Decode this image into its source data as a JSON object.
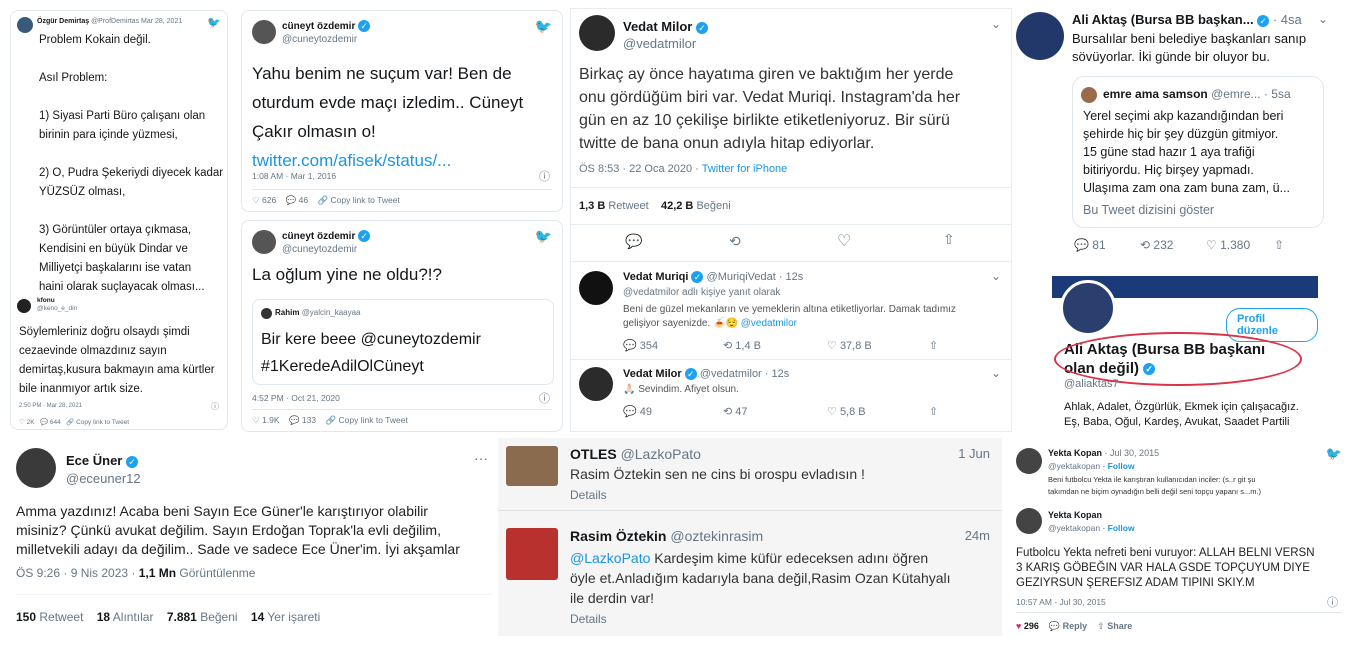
{
  "p1": {
    "user": "Özgür Demirtaş",
    "handle": "@ProfDemirtas",
    "date": "Mar 28, 2021",
    "lines": [
      "Problem Kokain değil.",
      "Asıl Problem:",
      "1) Siyasi Parti Büro çalışanı olan",
      "birinin para içinde yüzmesi,",
      "2) O, Pudra Şekeriydi diyecek kadar",
      "YÜZSÜZ olması,",
      "3) Görüntüler ortaya çıkmasa,",
      "Kendisini en büyük Dindar ve",
      "Milliyetçi başkalarını ise vatan",
      "haini olarak suçlayacak olması..."
    ],
    "reply_user": "kfonu",
    "reply_handle": "@keno_e_din",
    "reply_lines": [
      "Söylemleriniz doğru olsaydı şimdi",
      "cezaevinde olmazdınız sayın",
      "demirtaş,kusura bakmayın ama kürtler",
      "bile inanmıyor artık size."
    ],
    "footer_time": "2:50 PM · Mar 28, 2021",
    "likes": "2K",
    "retweets": "644",
    "copy": "Copy link to Tweet"
  },
  "p2": {
    "user": "cüneyt özdemir",
    "handle": "@cuneytozdemir",
    "lines": [
      "Yahu benim ne suçum var! Ben de",
      "oturdum evde maçı izledim.. Cüneyt",
      "Çakır olmasın o!"
    ],
    "link": "twitter.com/afisek/status/...",
    "time": "1:08 AM · Mar 1, 2016",
    "likes": "626",
    "retweets": "46",
    "copy": "Copy link to Tweet"
  },
  "p3": {
    "user": "cüneyt özdemir",
    "handle": "@cuneytozdemir",
    "text": "La oğlum yine ne oldu?!?",
    "quote_user": "Rahim",
    "quote_handle": "@yalcin_kaayaa",
    "quote_lines": [
      "Bir kere beee @cuneytozdemir",
      "#1KeredeAdilOlCüneyt"
    ],
    "time": "4:52 PM · Oct 21, 2020",
    "likes": "1.9K",
    "retweets": "133",
    "copy": "Copy link to Tweet"
  },
  "p4": {
    "user": "Vedat Milor",
    "handle": "@vedatmilor",
    "lines": [
      "Birkaç ay önce hayatıma giren ve baktığım her yerde",
      "onu gördüğüm biri var. Vedat Muriqi. Instagram'da her",
      "gün en az 10 çekilişe birlikte etiketleniyoruz. Bir sürü",
      "twitte de bana onun adıyla hitap ediyorlar."
    ],
    "time": "ÖS 8:53 · 22 Oca 2020 · ",
    "source": "Twitter for iPhone",
    "retweets_n": "1,3 B",
    "retweets_l": "Retweet",
    "likes_n": "42,2 B",
    "likes_l": "Beğeni",
    "r1_user": "Vedat Muriqi",
    "r1_handle": "@MuriqiVedat · 12s",
    "r1_replying": "@vedatmilor adlı kişiye yanıt olarak",
    "r1_lines": [
      "Beni de güzel mekanların ve yemeklerin altına etiketliyorlar. Damak tadımız",
      "gelişiyor sayenizde."
    ],
    "r1_mention": "@vedatmilor",
    "r1_replies": "354",
    "r1_rts": "1,4 B",
    "r1_likes": "37,8 B",
    "r2_user": "Vedat Milor",
    "r2_handle": "@vedatmilor · 12s",
    "r2_text": "Sevindim. Afiyet olsun.",
    "r2_replies": "49",
    "r2_rts": "47",
    "r2_likes": "5,8 B"
  },
  "p5": {
    "user": "Ali Aktaş (Bursa BB başkan...",
    "time": "4sa",
    "lines": [
      "Bursalılar beni belediye başkanları sanıp",
      "sövüyorlar. İki günde bir oluyor bu."
    ],
    "q_user": "emre ama samson",
    "q_handle": "@emre...",
    "q_time": "5sa",
    "q_lines": [
      "Yerel seçimi akp kazandığından beri",
      "şehirde hiç bir şey düzgün gitmiyor.",
      "15 güne stad hazır 1 aya trafiği",
      "bitiriyordu. Hiç birşey yapmadı.",
      "Ulaşıma zam ona zam buna zam, ü..."
    ],
    "q_thread": "Bu Tweet dizisini göster",
    "replies": "81",
    "rts": "232",
    "likes": "1.380"
  },
  "p6": {
    "edit": "Profil düzenle",
    "name_l1": "Ali Aktaş (Bursa BB başkanı",
    "name_l2": "olan değil)",
    "handle": "@aliaktas7",
    "bio1": "Ahlak, Adalet, Özgürlük, Ekmek için çalışacağız.",
    "bio2": "Eş, Baba, Oğul, Kardeş, Avukat, Saadet Partili"
  },
  "p7": {
    "user": "Ece Üner",
    "handle": "@eceuner12",
    "lines": [
      "Amma yazdınız! Acaba beni Sayın Ece Güner'le karıştırıyor olabilir",
      "misiniz? Çünkü avukat değilim. Sayın Erdoğan Toprak'la evli değilim,",
      "milletvekili adayı da değilim.. Sade ve sadece Ece Üner'im. İyi akşamlar"
    ],
    "time": "ÖS 9:26 · 9 Nis 2023 · ",
    "views_n": "1,1 Mn",
    "views_l": "Görüntülenme",
    "rt_n": "150",
    "rt_l": "Retweet",
    "q_n": "18",
    "q_l": "Alıntılar",
    "like_n": "7.881",
    "like_l": "Beğeni",
    "bm_n": "14",
    "bm_l": "Yer işareti"
  },
  "p8": {
    "t1_user": "OTLES",
    "t1_handle": "@LazkoPato",
    "t1_time": "1 Jun",
    "t1_text": "Rasim Öztekin sen ne cins bi orospu evladısın !",
    "details": "Details",
    "t2_user": "Rasim Öztekin",
    "t2_handle": "@oztekinrasim",
    "t2_time": "24m",
    "t2_mention": "@LazkoPato",
    "t2_l1": " Kardeşim kime küfür edeceksen adını öğren",
    "t2_l2": "öyle et.Anladığım kadarıyla bana değil,Rasim Ozan Kütahyalı",
    "t2_l3": "ile derdin var!"
  },
  "p9": {
    "t1_user": "Yekta Kopan",
    "t1_handle": "@yektakopan",
    "t1_date": "· Jul 30, 2015",
    "follow": "Follow",
    "t1_l1": "Beni futbolcu Yekta ile karıştıran kullanıcıdan inciler: (s..r git şu",
    "t1_l2": "takımdan ne biçim oynadığın belli değil seni topçu yapanı s...m.)",
    "t2_user": "Yekta Kopan",
    "t2_handle": "@yektakopan",
    "lines": [
      "Futbolcu Yekta nefreti beni vuruyor: ALLAH BELNI VERSN",
      "3 KARIŞ GÖBEĞIN VAR HALA GSDE TOPÇUYUM DIYE",
      "GEZIYRSUN ŞEREFSIZ ADAM TIPINI SKIY.M"
    ],
    "time": "10:57 AM - Jul 30, 2015",
    "likes": "296",
    "reply": "Reply",
    "share": "Share"
  }
}
